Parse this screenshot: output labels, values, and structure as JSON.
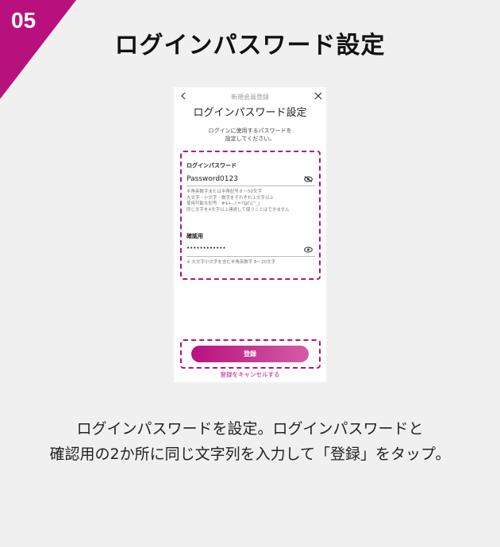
{
  "step": {
    "number": "05",
    "title": "ログインパスワード設定"
  },
  "screen": {
    "header": "新規会員登録",
    "title": "ログインパスワード設定",
    "instruction_line1": "ログインに使用するパスワードを",
    "instruction_line2": "設定してください。",
    "password": {
      "label": "ログインパスワード",
      "value": "Password0123",
      "hints": [
        "半角英数字または半角記号８〜50文字",
        "大文字・小文字・数字をそれぞれ１文字以上",
        "使用可能な記号　#$+-./:=?@[\\]^_|",
        "同じ文字を4文字以上連続して使うことはできません"
      ]
    },
    "confirm": {
      "label": "確認用",
      "value": "••••••••••••",
      "hint": "※ 大文字小文字を含む半角英数字 8〜20文字"
    },
    "submit_label": "登録",
    "cancel_label": "登録をキャンセルする"
  },
  "colors": {
    "accent": "#b8117e"
  },
  "description": {
    "line1": "ログインパスワードを設定。ログインパスワードと",
    "line2": "確認用の2か所に同じ文字列を入力して「登録」をタップ。"
  }
}
